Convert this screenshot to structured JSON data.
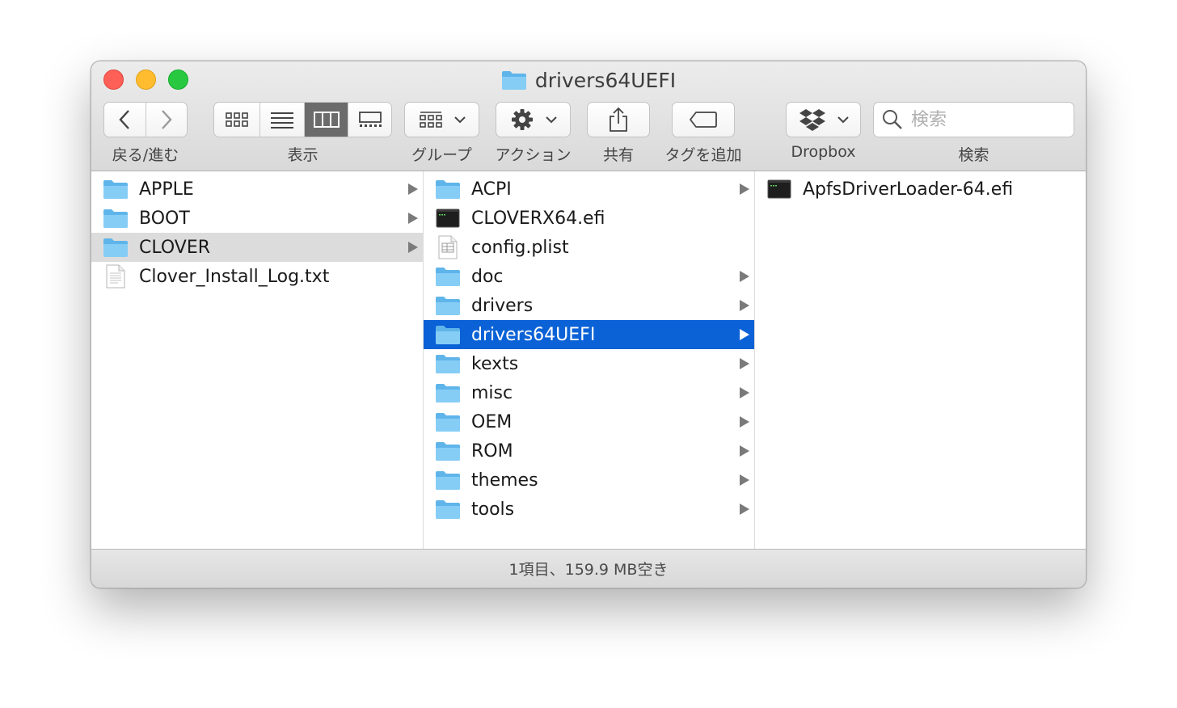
{
  "window": {
    "title": "drivers64UEFI"
  },
  "toolbar": {
    "nav_label": "戻る/進む",
    "view_label": "表示",
    "group_label": "グループ",
    "action_label": "アクション",
    "share_label": "共有",
    "tag_label": "タグを追加",
    "dropbox_label": "Dropbox",
    "search_label": "検索",
    "search_placeholder": "検索"
  },
  "column1": {
    "items": [
      {
        "name": "APPLE",
        "kind": "folder"
      },
      {
        "name": "BOOT",
        "kind": "folder"
      },
      {
        "name": "CLOVER",
        "kind": "folder"
      },
      {
        "name": "Clover_Install_Log.txt",
        "kind": "text"
      }
    ]
  },
  "column2": {
    "items": [
      {
        "name": "ACPI",
        "kind": "folder"
      },
      {
        "name": "CLOVERX64.efi",
        "kind": "exec"
      },
      {
        "name": "config.plist",
        "kind": "plist"
      },
      {
        "name": "doc",
        "kind": "folder"
      },
      {
        "name": "drivers",
        "kind": "folder"
      },
      {
        "name": "drivers64UEFI",
        "kind": "folder"
      },
      {
        "name": "kexts",
        "kind": "folder"
      },
      {
        "name": "misc",
        "kind": "folder"
      },
      {
        "name": "OEM",
        "kind": "folder"
      },
      {
        "name": "ROM",
        "kind": "folder"
      },
      {
        "name": "themes",
        "kind": "folder"
      },
      {
        "name": "tools",
        "kind": "folder"
      }
    ]
  },
  "column3": {
    "items": [
      {
        "name": "ApfsDriverLoader-64.efi",
        "kind": "exec"
      }
    ]
  },
  "status": {
    "text": "1項目、159.9 MB空き"
  },
  "colors": {
    "selection_blue": "#0b62d6",
    "selection_gray": "#dcdcdc",
    "folder": "#6cc3f3"
  }
}
